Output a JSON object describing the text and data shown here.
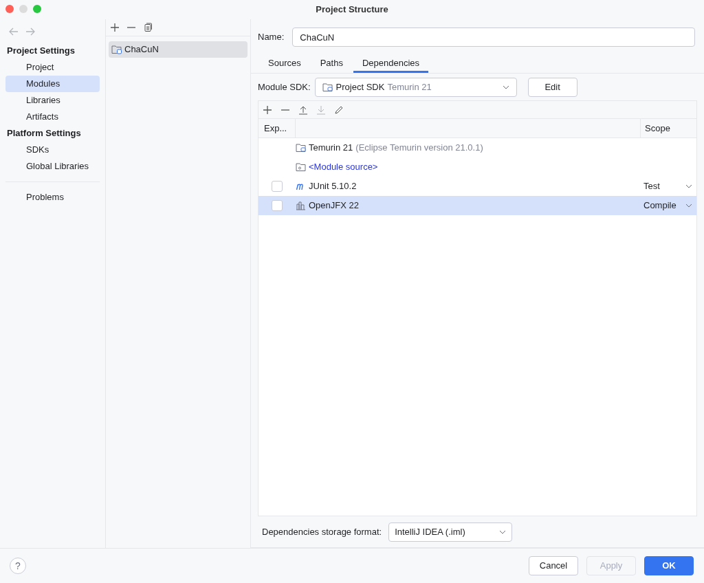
{
  "window": {
    "title": "Project Structure"
  },
  "sidebar": {
    "sections": [
      {
        "title": "Project Settings",
        "items": [
          {
            "label": "Project",
            "selected": false
          },
          {
            "label": "Modules",
            "selected": true
          },
          {
            "label": "Libraries",
            "selected": false
          },
          {
            "label": "Artifacts",
            "selected": false
          }
        ]
      },
      {
        "title": "Platform Settings",
        "items": [
          {
            "label": "SDKs",
            "selected": false
          },
          {
            "label": "Global Libraries",
            "selected": false
          }
        ]
      }
    ],
    "footer_items": [
      {
        "label": "Problems",
        "selected": false
      }
    ]
  },
  "modules": {
    "items": [
      {
        "name": "ChaCuN",
        "selected": true
      }
    ]
  },
  "name_field": {
    "label": "Name:",
    "value": "ChaCuN"
  },
  "tabs": [
    {
      "label": "Sources",
      "selected": false
    },
    {
      "label": "Paths",
      "selected": false
    },
    {
      "label": "Dependencies",
      "selected": true
    }
  ],
  "module_sdk": {
    "label": "Module SDK:",
    "value": "Project SDK",
    "detail": "Temurin 21",
    "button": "Edit"
  },
  "table": {
    "columns": [
      "Exp...",
      "",
      "Scope"
    ],
    "rows": [
      {
        "kind": "sdk",
        "name": "Temurin 21",
        "detail": "(Eclipse Temurin version 21.0.1)",
        "selected": false
      },
      {
        "kind": "module_source",
        "name": "<Module source>",
        "selected": false
      },
      {
        "kind": "maven_library",
        "name": "JUnit 5.10.2",
        "exported": false,
        "scope": "Test",
        "selected": false
      },
      {
        "kind": "library",
        "name": "OpenJFX 22",
        "exported": false,
        "scope": "Compile",
        "selected": true
      }
    ]
  },
  "storage_format": {
    "label": "Dependencies storage format:",
    "value": "IntelliJ IDEA (.iml)"
  },
  "help_button": "?",
  "buttons": [
    {
      "label": "Cancel",
      "kind": "default",
      "disabled": false
    },
    {
      "label": "Apply",
      "kind": "default",
      "disabled": true
    },
    {
      "label": "OK",
      "kind": "primary",
      "disabled": false
    }
  ]
}
